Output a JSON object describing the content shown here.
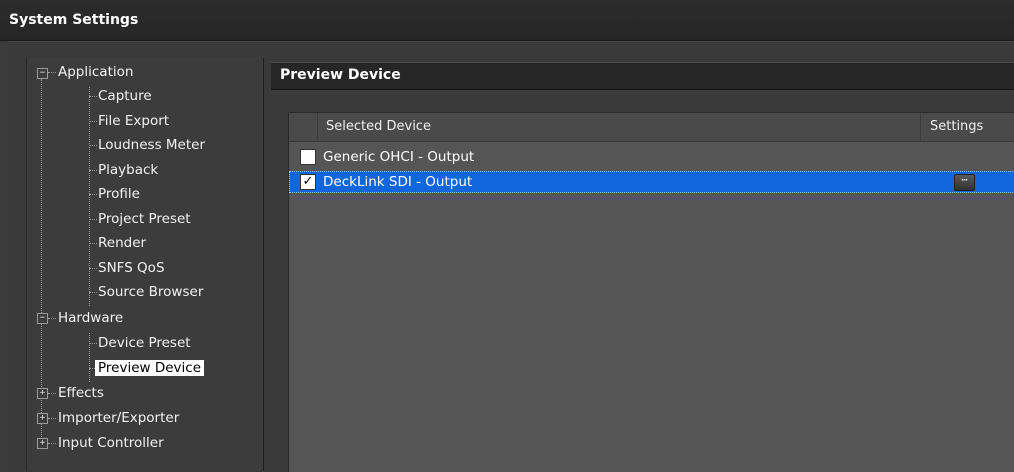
{
  "window": {
    "title": "System Settings"
  },
  "tree": {
    "nodes": [
      {
        "label": "Application",
        "expander": "−"
      },
      {
        "label": "Capture"
      },
      {
        "label": "File Export"
      },
      {
        "label": "Loudness Meter"
      },
      {
        "label": "Playback"
      },
      {
        "label": "Profile"
      },
      {
        "label": "Project Preset"
      },
      {
        "label": "Render"
      },
      {
        "label": "SNFS QoS"
      },
      {
        "label": "Source Browser"
      },
      {
        "label": "Hardware",
        "expander": "−"
      },
      {
        "label": "Device Preset"
      },
      {
        "label": "Preview Device",
        "selected": true
      },
      {
        "label": "Effects",
        "expander": "+"
      },
      {
        "label": "Importer/Exporter",
        "expander": "+"
      },
      {
        "label": "Input Controller",
        "expander": "+"
      }
    ]
  },
  "section": {
    "title": "Preview Device"
  },
  "device_list": {
    "columns": {
      "device": "Selected Device",
      "settings": "Settings"
    },
    "rows": [
      {
        "name": "Generic OHCI - Output",
        "checked": false,
        "check_glyph": ""
      },
      {
        "name": "DeckLink SDI - Output",
        "checked": true,
        "check_glyph": "✓",
        "settings_glyph": "⋯"
      }
    ]
  },
  "colors": {
    "selection": "#1166dd",
    "panel": "#3a3a3a",
    "header": "#262626",
    "list": "#555555"
  }
}
